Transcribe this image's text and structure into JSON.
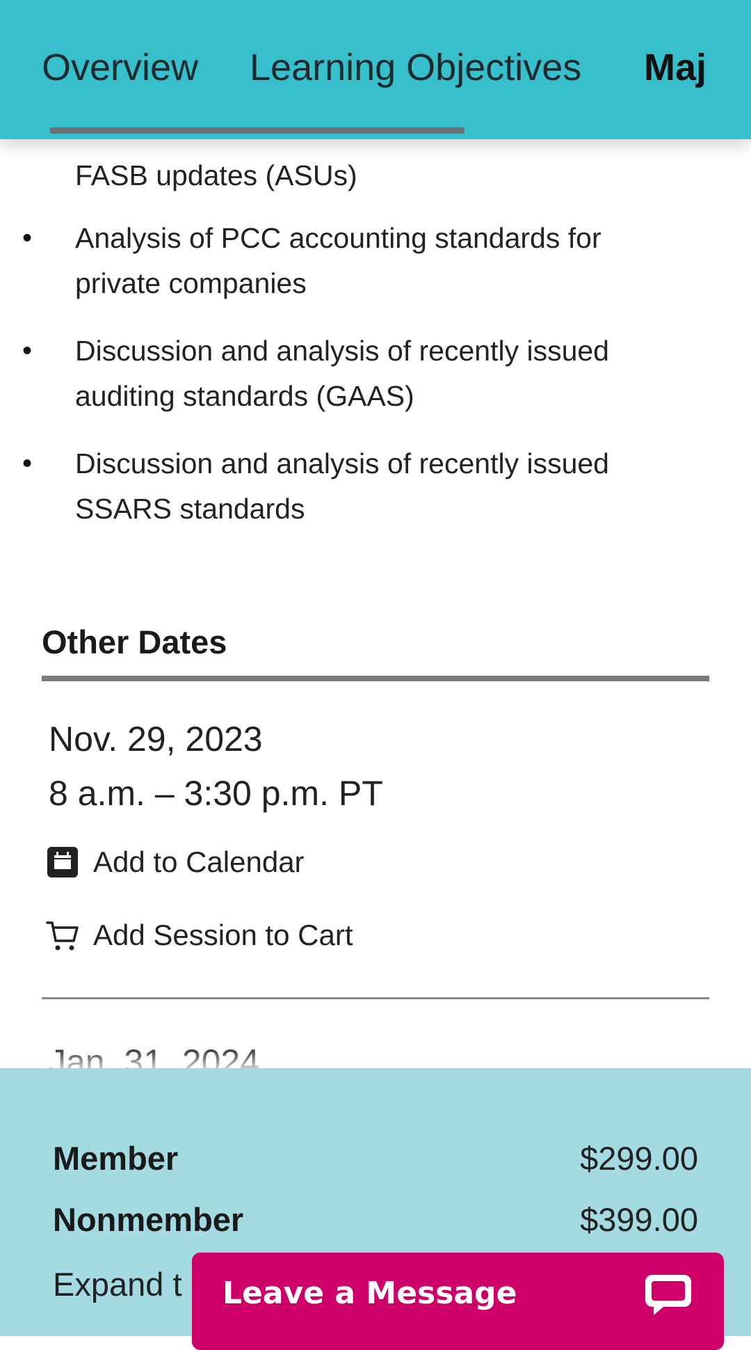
{
  "tabs": [
    {
      "label": "Overview"
    },
    {
      "label": "Learning Objectives"
    },
    {
      "label": "Maj"
    }
  ],
  "topics": [
    {
      "text": "FASB updates (ASUs)"
    },
    {
      "text": "Analysis of PCC accounting standards for private companies"
    },
    {
      "text": "Discussion and analysis of recently issued auditing standards (GAAS)"
    },
    {
      "text": "Discussion and analysis of recently issued SSARS standards"
    }
  ],
  "other_dates": {
    "title": "Other Dates",
    "sessions": [
      {
        "date": "Nov. 29, 2023",
        "time": "8 a.m. – 3:30 p.m. PT",
        "add_to_calendar": "Add to Calendar",
        "add_to_cart": "Add Session to Cart"
      },
      {
        "date": "Jan. 31, 2024"
      }
    ]
  },
  "pricing": {
    "member_label": "Member",
    "member_price": "$299.00",
    "nonmember_label": "Nonmember",
    "nonmember_price": "$399.00",
    "expand_text": "Expand t"
  },
  "chat": {
    "label": "Leave a Message"
  },
  "icons": {
    "calendar": "calendar-icon",
    "cart": "cart-icon",
    "chat": "chat-bubble-icon"
  },
  "colors": {
    "tab_bar": "#38bfcc",
    "price_panel": "#a4dbe3",
    "chat_button": "#cc0068"
  }
}
